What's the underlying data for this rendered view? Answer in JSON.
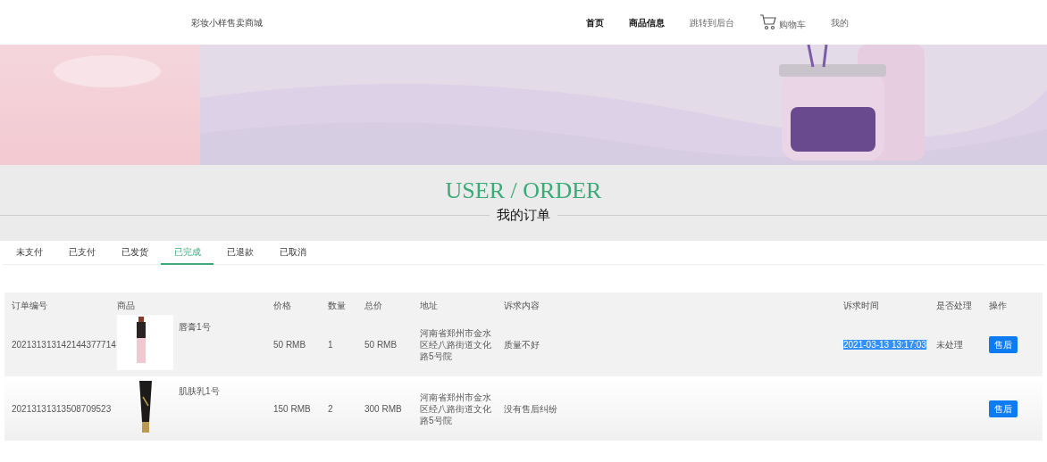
{
  "header": {
    "site_name": "彩妆小样售卖商城",
    "nav": [
      {
        "label": "首页",
        "selected": true,
        "kind": "link"
      },
      {
        "label": "商品信息",
        "selected": true,
        "kind": "link"
      },
      {
        "label": "跳转到后台",
        "selected": false,
        "kind": "link"
      },
      {
        "label": "购物车",
        "selected": false,
        "kind": "cart"
      },
      {
        "label": "我的",
        "selected": false,
        "kind": "link"
      }
    ]
  },
  "section": {
    "title": "USER / ORDER",
    "subtitle": "我的订单"
  },
  "tabs": [
    {
      "label": "未支付",
      "selected": false
    },
    {
      "label": "已支付",
      "selected": false
    },
    {
      "label": "已发货",
      "selected": false
    },
    {
      "label": "已完成",
      "selected": true
    },
    {
      "label": "已退款",
      "selected": false
    },
    {
      "label": "已取消",
      "selected": false
    }
  ],
  "table": {
    "columns": [
      "订单编号",
      "商品",
      "价格",
      "数量",
      "总价",
      "地址",
      "诉求内容",
      "诉求时间",
      "是否处理",
      "操作"
    ],
    "rows": [
      {
        "order_no": "202131313142144377714",
        "product": {
          "kind": "lipstick",
          "name": "唇膏1号"
        },
        "price": "50 RMB",
        "quantity": "1",
        "total": "50 RMB",
        "address": "河南省郑州市金水区经八路街道文化路5号院",
        "request": "质量不好",
        "request_time": "2021-03-13 13:17:03",
        "time_highlighted": true,
        "handled": "未处理",
        "action": "售后"
      },
      {
        "order_no": "20213131313508709523",
        "product": {
          "kind": "tube",
          "name": "肌肤乳1号"
        },
        "price": "150 RMB",
        "quantity": "2",
        "total": "300 RMB",
        "address": "河南省郑州市金水区经八路街道文化路5号院",
        "request": "没有售后纠纷",
        "action": "售后"
      }
    ]
  }
}
